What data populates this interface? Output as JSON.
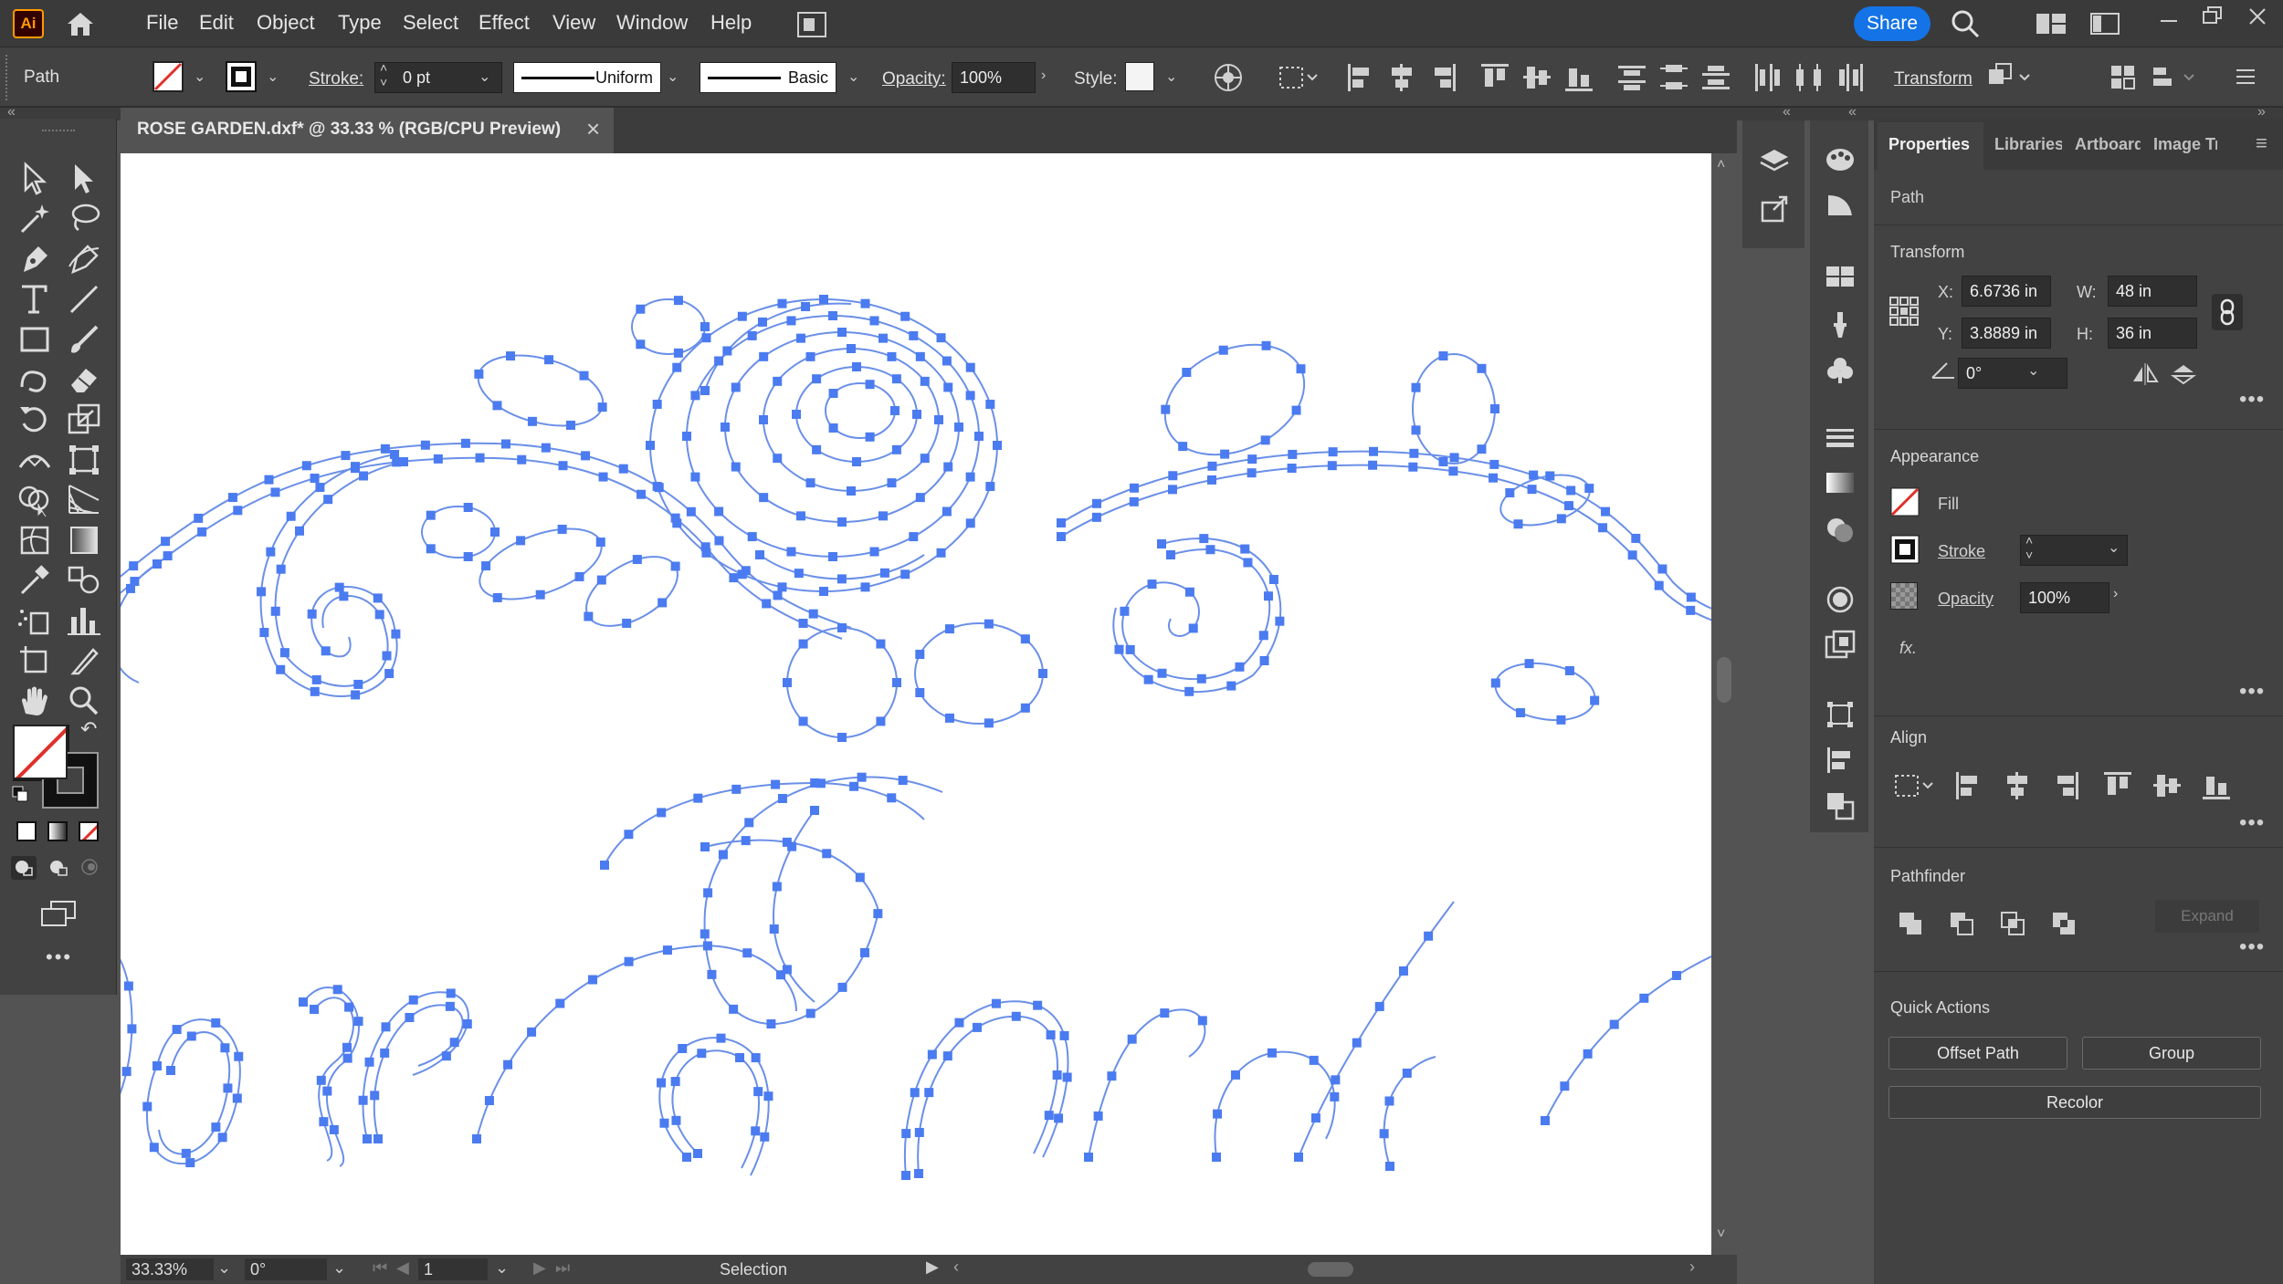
{
  "app": {
    "logo_text": "Ai",
    "logo_bg": "#FF9A00",
    "logo_fg": "#330000"
  },
  "menu": [
    "File",
    "Edit",
    "Object",
    "Type",
    "Select",
    "Effect",
    "View",
    "Window",
    "Help"
  ],
  "share_label": "Share",
  "control_bar": {
    "selection_type": "Path",
    "stroke_label": "Stroke:",
    "stroke_value": "0 pt",
    "profile_uniform": "Uniform",
    "brush_basic": "Basic",
    "opacity_label": "Opacity:",
    "opacity_value": "100%",
    "style_label": "Style:",
    "transform_label": "Transform"
  },
  "document": {
    "tab_title": "ROSE GARDEN.dxf* @ 33.33 % (RGB/CPU Preview)",
    "close_icon": "×"
  },
  "status_bar": {
    "zoom": "33.33%",
    "rotation": "0°",
    "artboard": "1",
    "tool_name": "Selection"
  },
  "properties": {
    "tabs": [
      "Properties",
      "Libraries",
      "Artboards",
      "Image Trace"
    ],
    "object_type": "Path",
    "transform": {
      "title": "Transform",
      "x_label": "X:",
      "x_value": "6.6736 in",
      "y_label": "Y:",
      "y_value": "3.8889 in",
      "w_label": "W:",
      "w_value": "48 in",
      "h_label": "H:",
      "h_value": "36 in",
      "angle_value": "0°"
    },
    "appearance": {
      "title": "Appearance",
      "fill_label": "Fill",
      "stroke_label": "Stroke",
      "opacity_label": "Opacity",
      "opacity_value": "100%",
      "fx_label": "fx."
    },
    "align": {
      "title": "Align"
    },
    "pathfinder": {
      "title": "Pathfinder",
      "expand_label": "Expand"
    },
    "quick_actions": {
      "title": "Quick Actions",
      "offset_path": "Offset Path",
      "group": "Group",
      "recolor": "Recolor"
    }
  },
  "colors": {
    "selection_blue": "#4B7BF0",
    "share_blue": "#1473E6",
    "none_red": "#E0302A"
  }
}
